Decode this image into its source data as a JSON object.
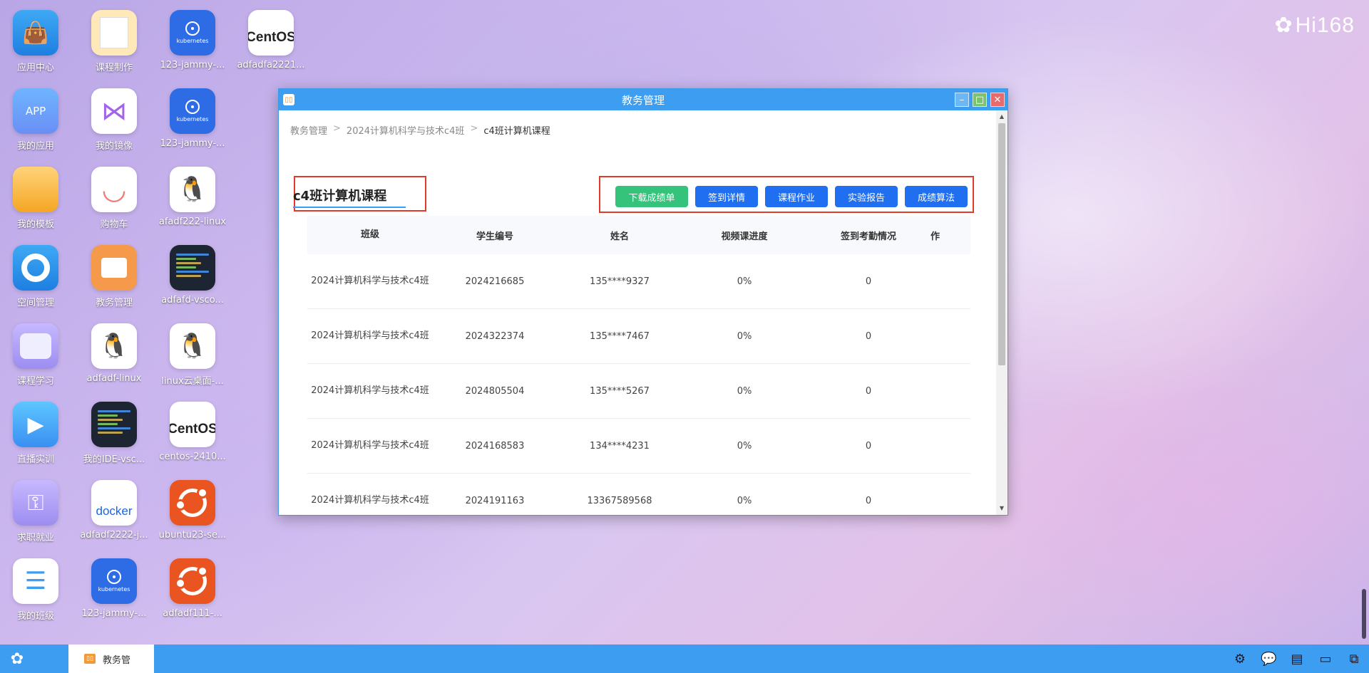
{
  "brand": {
    "logo_text": "Hi168",
    "icon": "bear-icon"
  },
  "desktop_icons": [
    {
      "label": "应用中心",
      "icon": "shopping-bag-icon"
    },
    {
      "label": "课程制作",
      "icon": "notebook-icon"
    },
    {
      "label": "123-jammy-...",
      "icon": "kubernetes-icon"
    },
    {
      "label": "adfadfa2221...",
      "icon": "centos-icon"
    },
    {
      "label": "我的应用",
      "icon": "app-icon"
    },
    {
      "label": "我的镜像",
      "icon": "visual-studio-icon"
    },
    {
      "label": "123-jammy-...",
      "icon": "kubernetes-icon"
    },
    {
      "label": "我的模板",
      "icon": "folder-icon"
    },
    {
      "label": "购物车",
      "icon": "smile-icon"
    },
    {
      "label": "afadf222-linux",
      "icon": "linux-tux-icon"
    },
    {
      "label": "空间管理",
      "icon": "disk-icon"
    },
    {
      "label": "教务管理",
      "icon": "book-open-icon"
    },
    {
      "label": "adfafd-vsco...",
      "icon": "code-editor-icon"
    },
    {
      "label": "课程学习",
      "icon": "window-icon"
    },
    {
      "label": "adfadf-linux",
      "icon": "linux-tux-icon"
    },
    {
      "label": "linux云桌面-...",
      "icon": "linux-tux-icon"
    },
    {
      "label": "直播实训",
      "icon": "play-icon"
    },
    {
      "label": "我的IDE-vsc...",
      "icon": "code-editor-icon"
    },
    {
      "label": "centos-2410...",
      "icon": "centos-icon"
    },
    {
      "label": "求职就业",
      "icon": "key-icon"
    },
    {
      "label": "adfadf2222-j...",
      "icon": "docker-icon"
    },
    {
      "label": "ubuntu23-se...",
      "icon": "ubuntu-icon"
    },
    {
      "label": "我的班级",
      "icon": "list-icon"
    },
    {
      "label": "123-jammy-...",
      "icon": "kubernetes-icon"
    },
    {
      "label": "adfadf111-...",
      "icon": "ubuntu-icon"
    }
  ],
  "icon_text": {
    "app": "APP",
    "kubernetes": "kubernetes",
    "centos": "CentOS",
    "docker": "docker"
  },
  "window": {
    "title": "教务管理",
    "breadcrumb": [
      "教务管理",
      "2024计算机科学与技术c4班",
      "c4班计算机课程"
    ],
    "breadcrumb_sep": ">",
    "course_title": "c4班计算机课程",
    "buttons": [
      "下载成绩单",
      "签到详情",
      "课程作业",
      "实验报告",
      "成绩算法"
    ],
    "table": {
      "headers": [
        "班级",
        "学生编号",
        "姓名",
        "视频课进度",
        "签到考勤情况",
        "作"
      ],
      "rows": [
        [
          "2024计算机科学与技术c4班",
          "2024216685",
          "135****9327",
          "0%",
          "0"
        ],
        [
          "2024计算机科学与技术c4班",
          "2024322374",
          "135****7467",
          "0%",
          "0"
        ],
        [
          "2024计算机科学与技术c4班",
          "2024805504",
          "135****5267",
          "0%",
          "0"
        ],
        [
          "2024计算机科学与技术c4班",
          "2024168583",
          "134****4231",
          "0%",
          "0"
        ],
        [
          "2024计算机科学与技术c4班",
          "2024191163",
          "13367589568",
          "0%",
          "0"
        ]
      ]
    }
  },
  "taskbar": {
    "start_icon": "bear-icon",
    "task_label": "教务管",
    "tray_icons": [
      "gear-icon",
      "wechat-icon",
      "chat-icon",
      "monitor-icon",
      "cast-icon"
    ]
  }
}
